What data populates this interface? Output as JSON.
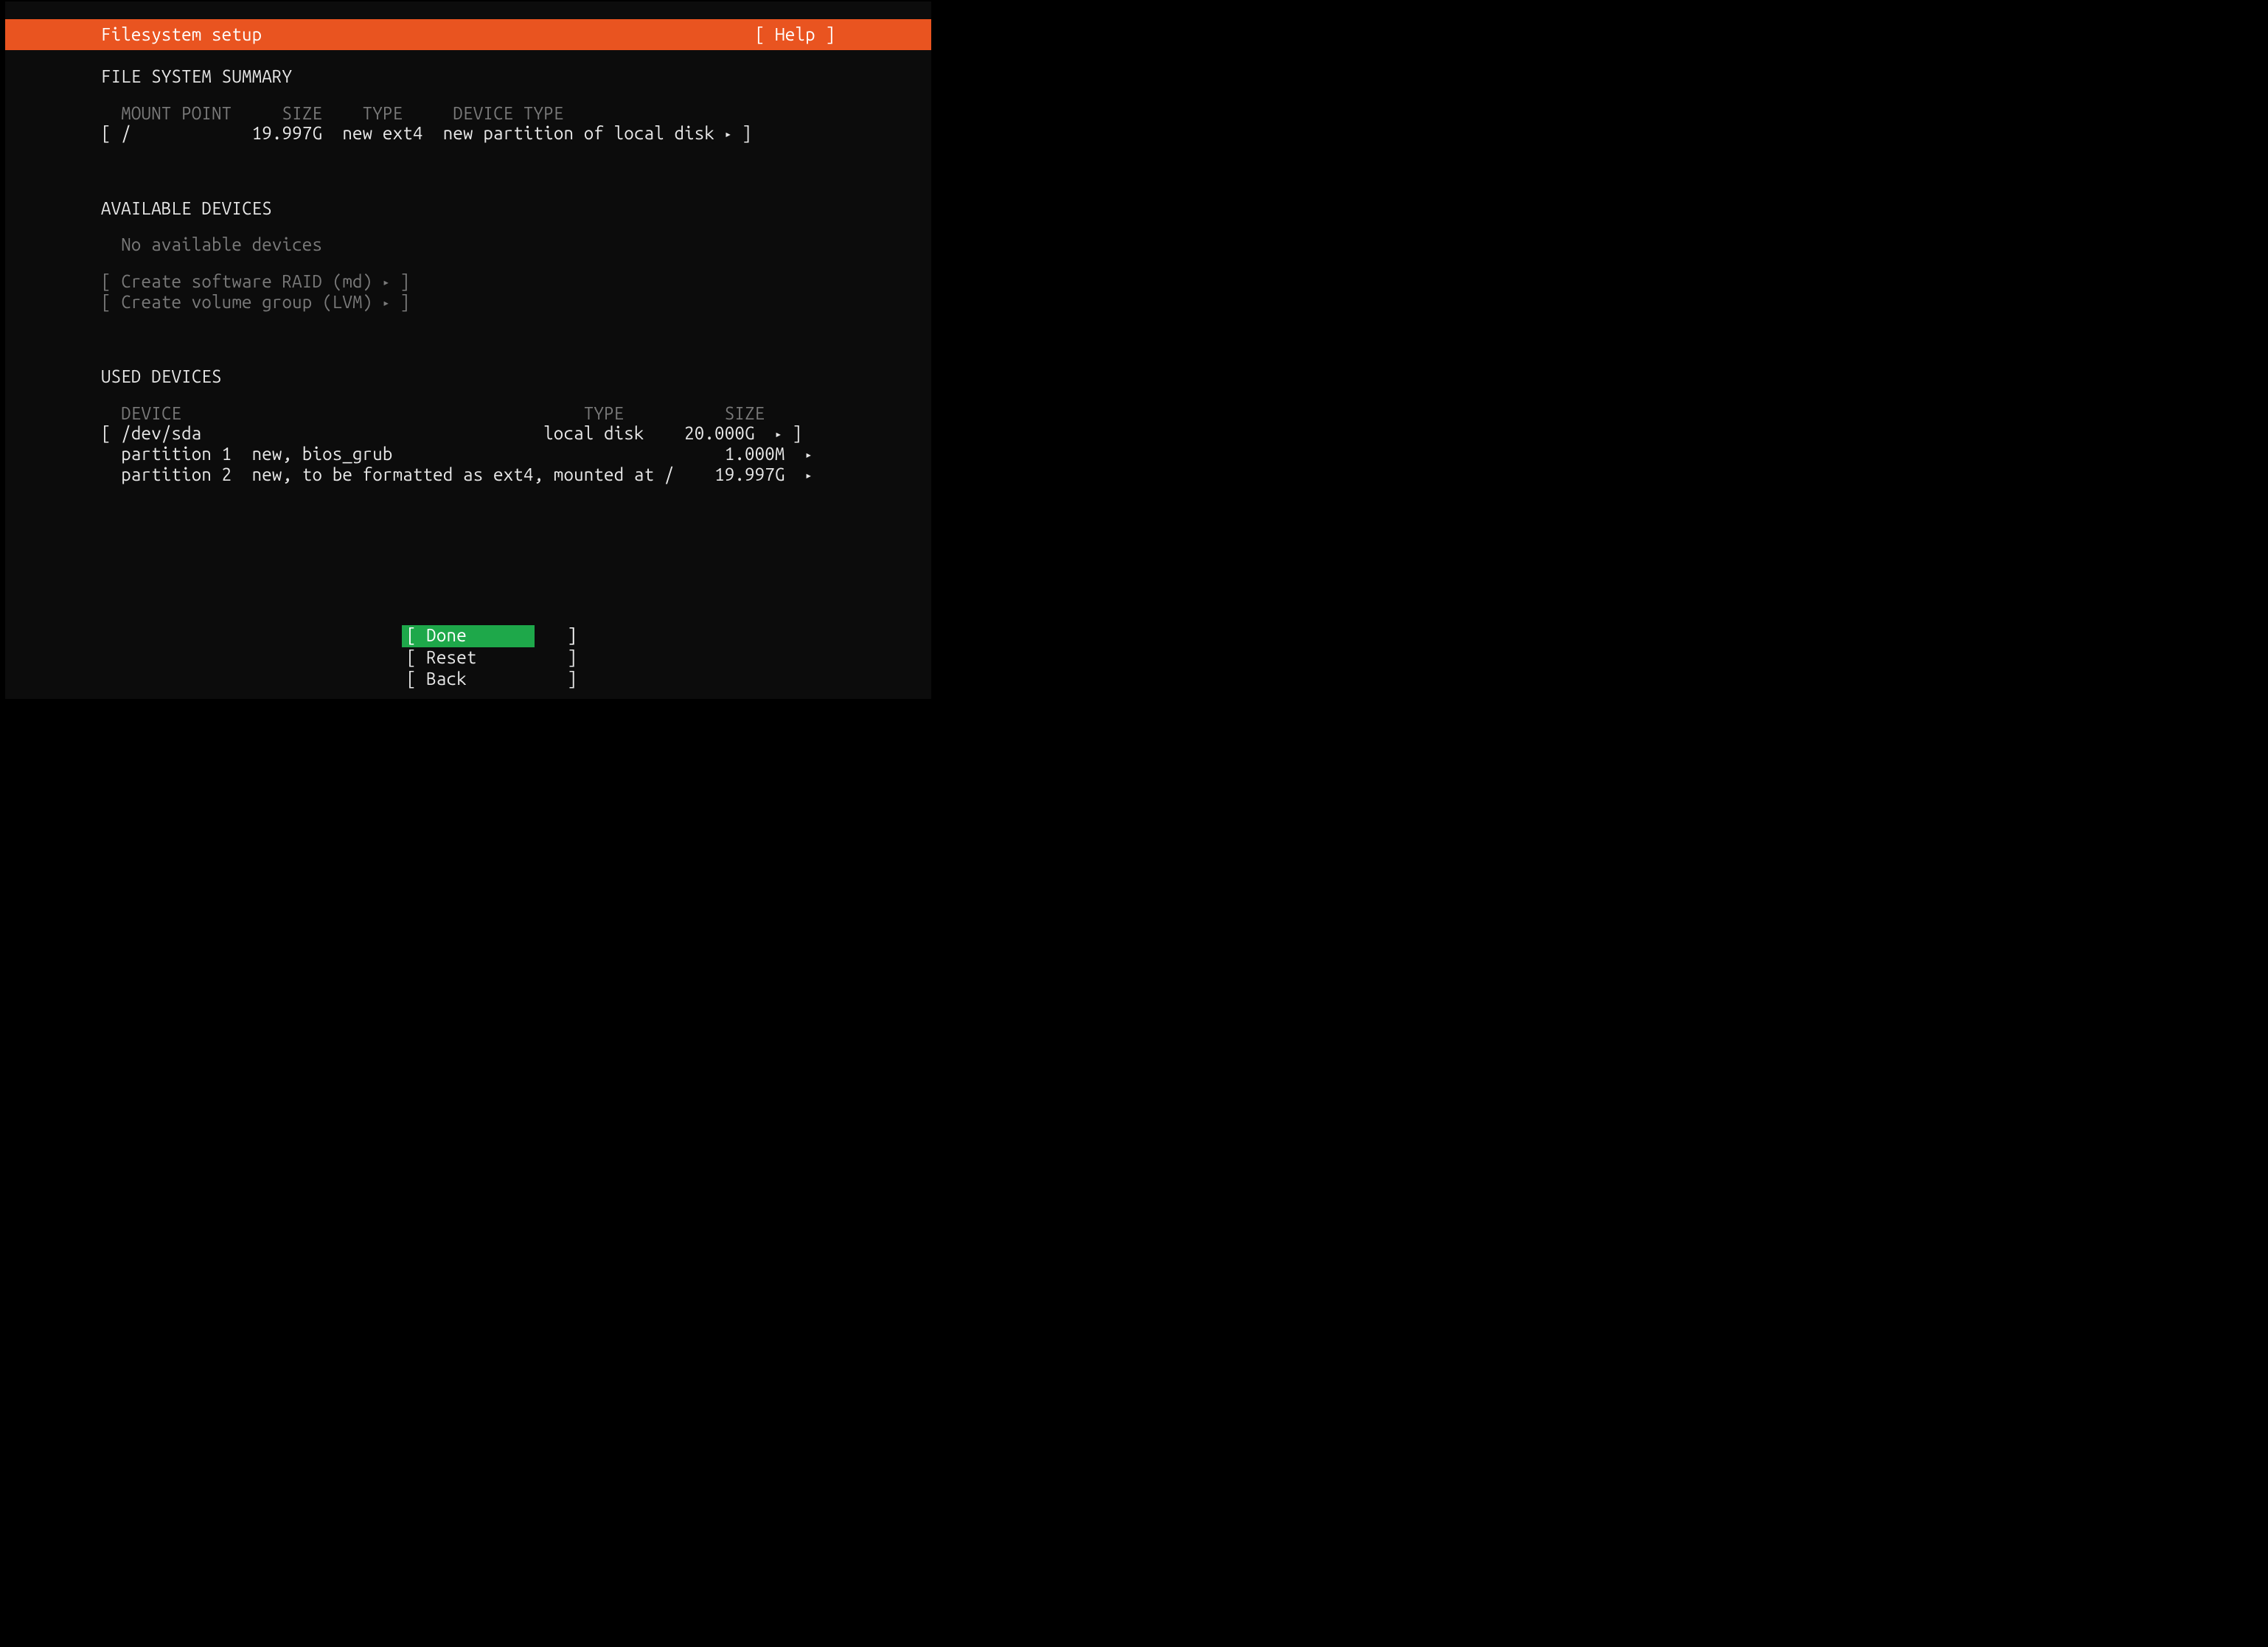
{
  "header": {
    "title": "Filesystem setup",
    "help": "[ Help ]"
  },
  "summary": {
    "title": "FILE SYSTEM SUMMARY",
    "cols": {
      "mount": "MOUNT POINT",
      "size": "SIZE",
      "type": "TYPE",
      "devtype": "DEVICE TYPE"
    },
    "row": {
      "lb": "[ ",
      "mount": "/",
      "size": "19.997G",
      "type": "new ext4",
      "devtype": "new partition of local disk",
      "tri": "▸",
      "rb": " ]"
    }
  },
  "avail": {
    "title": "AVAILABLE DEVICES",
    "none": "No available devices",
    "raid": {
      "lb": "[ ",
      "text": "Create software RAID (md)",
      "tri": "▸",
      "rb": " ]"
    },
    "lvm": {
      "lb": "[ ",
      "text": "Create volume group (LVM)",
      "tri": "▸",
      "rb": " ]"
    }
  },
  "used": {
    "title": "USED DEVICES",
    "cols": {
      "device": "DEVICE",
      "type": "TYPE",
      "size": "SIZE"
    },
    "disk": {
      "lb": "[ ",
      "name": "/dev/sda",
      "type": "local disk",
      "size": "20.000G",
      "tri": "▸",
      "rb": " ]"
    },
    "p1": {
      "name": "partition 1",
      "desc": "new, bios_grub",
      "size": "1.000M",
      "tri": "▸"
    },
    "p2": {
      "name": "partition 2",
      "desc": "new, to be formatted as ext4, mounted at /",
      "size": "19.997G",
      "tri": "▸"
    }
  },
  "footer": {
    "done": "[ Done          ]",
    "reset": "[ Reset         ]",
    "back": "[ Back          ]"
  }
}
